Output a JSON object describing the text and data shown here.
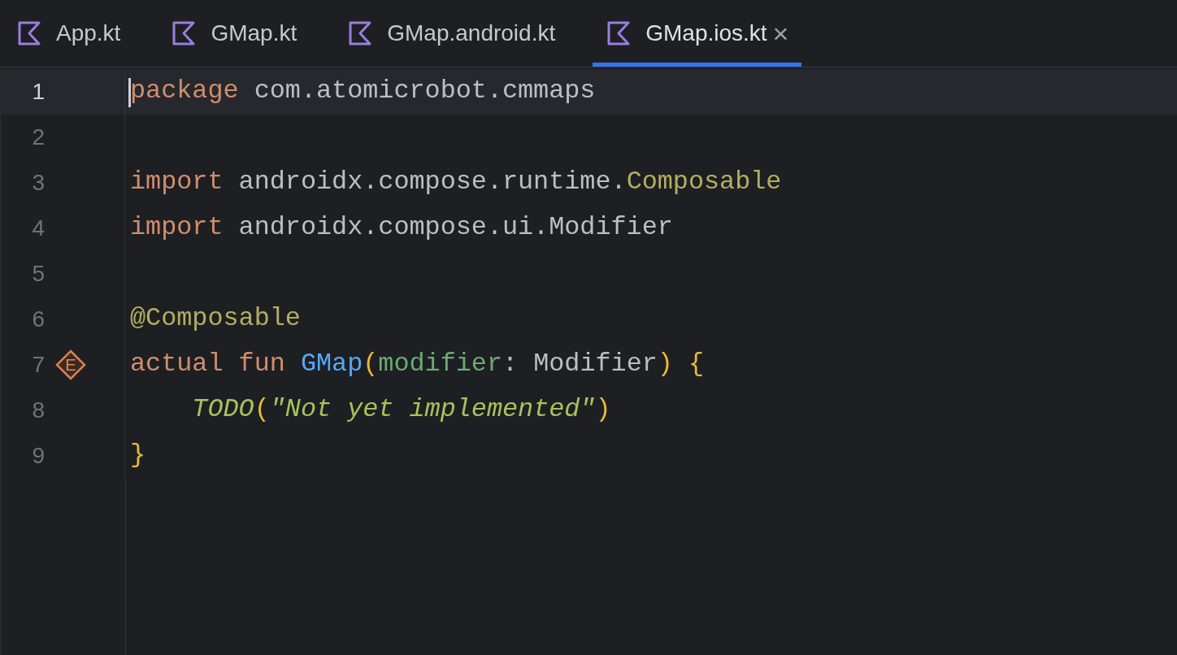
{
  "tabs": [
    {
      "label": "App.kt",
      "selected": false,
      "closable": false
    },
    {
      "label": "GMap.kt",
      "selected": false,
      "closable": false
    },
    {
      "label": "GMap.android.kt",
      "selected": false,
      "closable": false
    },
    {
      "label": "GMap.ios.kt",
      "selected": true,
      "closable": true
    }
  ],
  "close_glyph": "×",
  "editor": {
    "lines": [
      {
        "number": "1",
        "current": true,
        "cursor": true,
        "tokens": [
          {
            "kind": "keyword",
            "text": "package"
          },
          {
            "kind": "plain",
            "text": " com.atomicrobot.cmmaps"
          }
        ]
      },
      {
        "number": "2",
        "current": false,
        "cursor": false
      },
      {
        "number": "3",
        "current": false,
        "cursor": false,
        "tokens": [
          {
            "kind": "keyword",
            "text": "import"
          },
          {
            "kind": "plain",
            "text": " androidx.compose.runtime."
          },
          {
            "kind": "annotation",
            "text": "Composable"
          }
        ]
      },
      {
        "number": "4",
        "current": false,
        "cursor": false,
        "tokens": [
          {
            "kind": "keyword",
            "text": "import"
          },
          {
            "kind": "plain",
            "text": " androidx.compose.ui.Modifier"
          }
        ]
      },
      {
        "number": "5",
        "current": false,
        "cursor": false
      },
      {
        "number": "6",
        "current": false,
        "cursor": false,
        "tokens": [
          {
            "kind": "annotation",
            "text": "@Composable"
          }
        ]
      },
      {
        "number": "7",
        "current": false,
        "cursor": false,
        "marker": "E",
        "tokens": [
          {
            "kind": "keyword",
            "text": "actual fun "
          },
          {
            "kind": "declaration",
            "text": "GMap"
          },
          {
            "kind": "bracket",
            "text": "("
          },
          {
            "kind": "parameter",
            "text": "modifier"
          },
          {
            "kind": "plain",
            "text": ": Modifier"
          },
          {
            "kind": "bracket",
            "text": ")"
          },
          {
            "kind": "bracket",
            "text": " {"
          }
        ]
      },
      {
        "number": "8",
        "current": false,
        "cursor": false,
        "tokens": [
          {
            "kind": "call",
            "text": "    TODO"
          },
          {
            "kind": "bracket",
            "text": "("
          },
          {
            "kind": "string",
            "text": "\"Not yet implemented\""
          },
          {
            "kind": "bracket",
            "text": ")"
          }
        ]
      },
      {
        "number": "9",
        "current": false,
        "cursor": false,
        "tokens": [
          {
            "kind": "bracket",
            "text": "}"
          }
        ]
      }
    ]
  }
}
